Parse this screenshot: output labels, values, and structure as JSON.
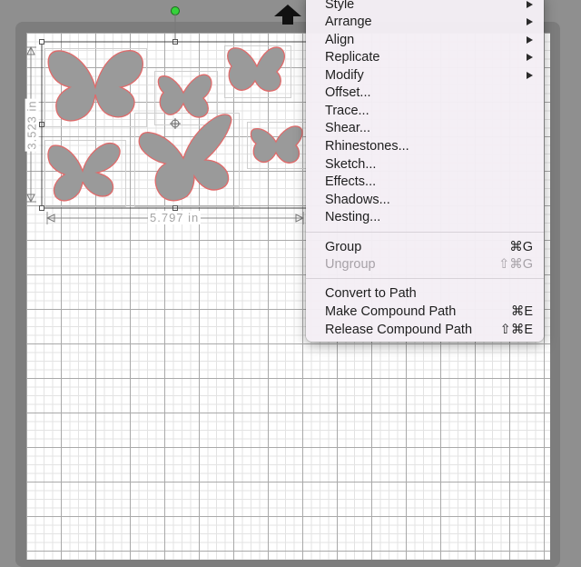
{
  "menu": {
    "items": [
      {
        "label": "Style",
        "submenu": true
      },
      {
        "label": "Arrange",
        "submenu": true
      },
      {
        "label": "Align",
        "submenu": true
      },
      {
        "label": "Replicate",
        "submenu": true
      },
      {
        "label": "Modify",
        "submenu": true
      },
      {
        "label": "Offset..."
      },
      {
        "label": "Trace..."
      },
      {
        "label": "Shear..."
      },
      {
        "label": "Rhinestones..."
      },
      {
        "label": "Sketch..."
      },
      {
        "label": "Effects..."
      },
      {
        "label": "Shadows..."
      },
      {
        "label": "Nesting..."
      }
    ],
    "group": {
      "label": "Group",
      "shortcut": "⌘G"
    },
    "ungroup": {
      "label": "Ungroup",
      "shortcut": "⇧⌘G",
      "disabled": true
    },
    "convert_to_path": {
      "label": "Convert to Path"
    },
    "make_compound": {
      "label": "Make Compound Path",
      "shortcut": "⌘E"
    },
    "release_compound": {
      "label": "Release Compound Path",
      "shortcut": "⇧⌘E"
    }
  },
  "selection": {
    "width_label": "5.797 in",
    "height_label": "3.523 in"
  },
  "colors": {
    "shape_fill": "#9a9a9a",
    "shape_outline": "#e06a6a",
    "origin": "#35d23a"
  }
}
